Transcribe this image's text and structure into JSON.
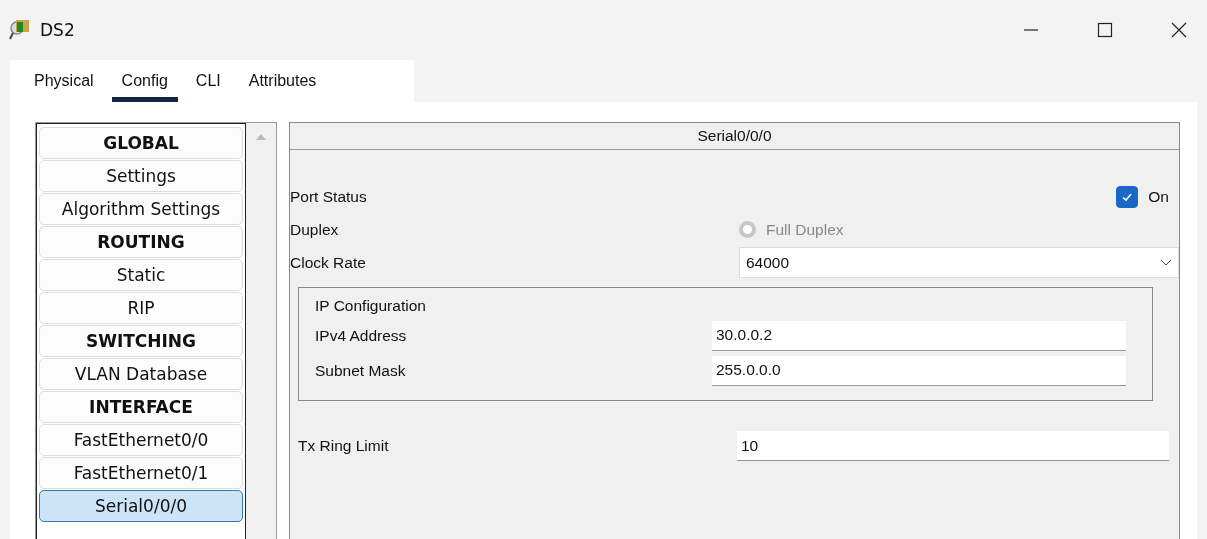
{
  "window": {
    "title": "DS2"
  },
  "tabs": [
    {
      "label": "Physical",
      "selected": false
    },
    {
      "label": "Config",
      "selected": true
    },
    {
      "label": "CLI",
      "selected": false
    },
    {
      "label": "Attributes",
      "selected": false
    }
  ],
  "sidebar": {
    "items": [
      {
        "label": "GLOBAL",
        "kind": "header",
        "selected": false
      },
      {
        "label": "Settings",
        "kind": "item",
        "selected": false
      },
      {
        "label": "Algorithm Settings",
        "kind": "item",
        "selected": false
      },
      {
        "label": "ROUTING",
        "kind": "header",
        "selected": false
      },
      {
        "label": "Static",
        "kind": "item",
        "selected": false
      },
      {
        "label": "RIP",
        "kind": "item",
        "selected": false
      },
      {
        "label": "SWITCHING",
        "kind": "header",
        "selected": false
      },
      {
        "label": "VLAN Database",
        "kind": "item",
        "selected": false
      },
      {
        "label": "INTERFACE",
        "kind": "header",
        "selected": false
      },
      {
        "label": "FastEthernet0/0",
        "kind": "item",
        "selected": false
      },
      {
        "label": "FastEthernet0/1",
        "kind": "item",
        "selected": false
      },
      {
        "label": "Serial0/0/0",
        "kind": "item",
        "selected": true
      }
    ]
  },
  "panel": {
    "title": "Serial0/0/0",
    "port_status": {
      "label": "Port Status",
      "checkbox_label": "On",
      "checked": true
    },
    "duplex": {
      "label": "Duplex",
      "option": "Full Duplex",
      "selected": false,
      "disabled": true
    },
    "clock_rate": {
      "label": "Clock Rate",
      "value": "64000"
    },
    "ip_configuration": {
      "title": "IP Configuration",
      "fields": [
        {
          "label": "IPv4 Address",
          "value": "30.0.0.2"
        },
        {
          "label": "Subnet Mask",
          "value": "255.0.0.0"
        }
      ]
    },
    "tx_ring_limit": {
      "label": "Tx Ring Limit",
      "value": "10"
    }
  }
}
